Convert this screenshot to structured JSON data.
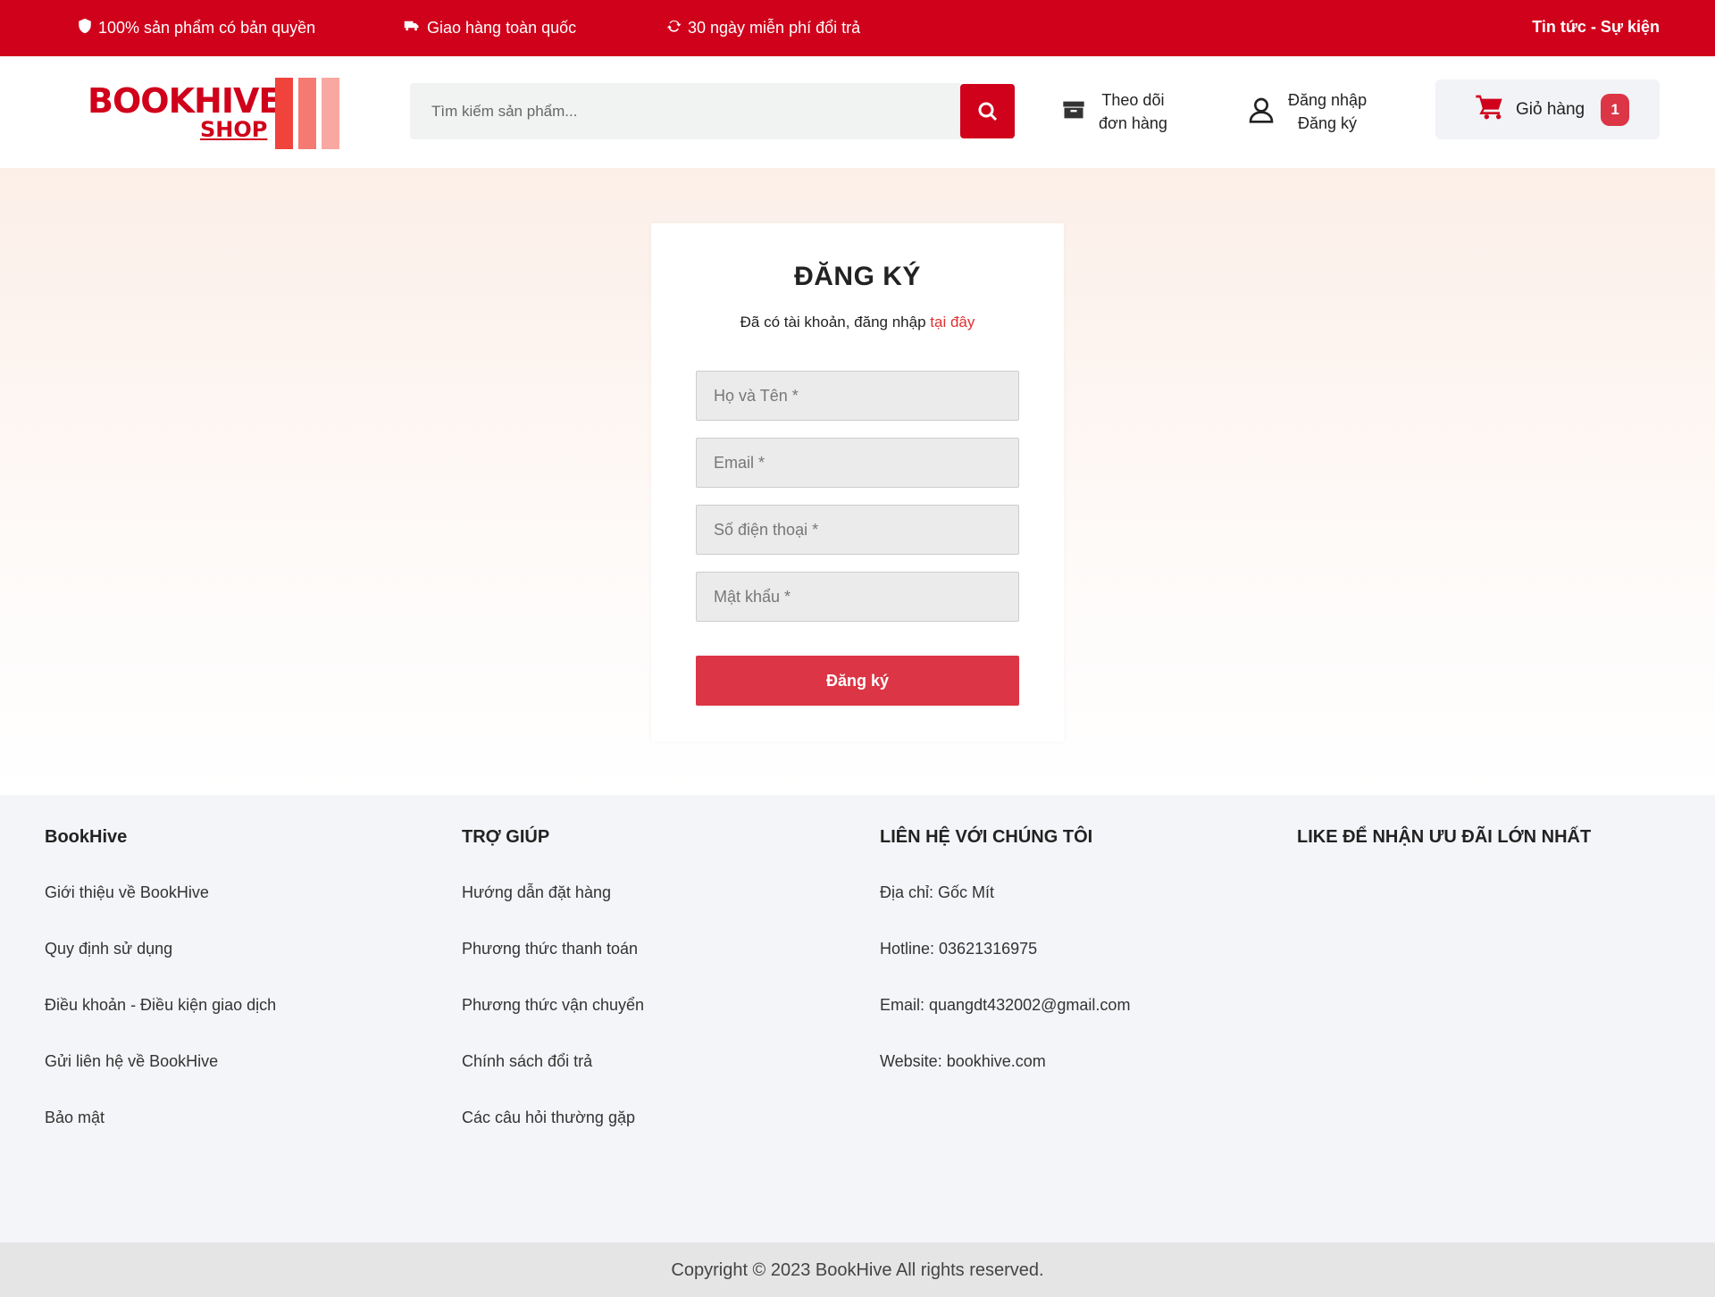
{
  "topbar": {
    "perks": [
      {
        "icon": "shield-icon",
        "label": "100% sản phẩm có bản quyền"
      },
      {
        "icon": "truck-icon",
        "label": "Giao hàng toàn quốc"
      },
      {
        "icon": "refresh-icon",
        "label": "30 ngày miễn phí đổi trả"
      }
    ],
    "news_link": "Tin tức - Sự kiện",
    "background_color": "#d0011b"
  },
  "header": {
    "logo": {
      "word1": "BOOKHIVE",
      "word2": "SHOP",
      "colors": [
        "#f0433c",
        "#f47a72",
        "#f8a8a0"
      ]
    },
    "search": {
      "placeholder": "Tìm kiếm sản phẩm..."
    },
    "track_order": {
      "line1": "Theo dõi",
      "line2": "đơn hàng"
    },
    "account": {
      "login": "Đăng nhập",
      "register": "Đăng ký"
    },
    "cart": {
      "label": "Giỏ hàng",
      "count": "1"
    }
  },
  "register_form": {
    "title": "ĐĂNG KÝ",
    "have_account_text": "Đã có tài khoản, đăng nhập ",
    "login_link": "tại đây",
    "fields": [
      {
        "placeholder": "Họ và Tên *"
      },
      {
        "placeholder": "Email *"
      },
      {
        "placeholder": "Số điện thoại *"
      },
      {
        "placeholder": "Mật khẩu *"
      }
    ],
    "submit_label": "Đăng ký",
    "accent_color": "#dc3545"
  },
  "footer": {
    "columns": [
      {
        "title": "BookHive",
        "items": [
          "Giới thiệu về BookHive",
          "Quy định sử dụng",
          "Điều khoản - Điều kiện giao dịch",
          "Gửi liên hệ về BookHive",
          "Bảo mật"
        ]
      },
      {
        "title": "TRỢ GIÚP",
        "items": [
          "Hướng dẫn đặt hàng",
          "Phương thức thanh toán",
          "Phương thức vận chuyển",
          "Chính sách đổi trả",
          "Các câu hỏi thường gặp"
        ]
      },
      {
        "title": "LIÊN HỆ VỚI CHÚNG TÔI",
        "items": [
          "Địa chỉ: Gốc Mít",
          "Hotline: 03621316975",
          "Email: quangdt432002@gmail.com",
          "Website: bookhive.com"
        ]
      },
      {
        "title": "LIKE ĐỂ NHẬN ƯU ĐÃI LỚN NHẤT",
        "items": []
      }
    ],
    "copyright": "Copyright © 2023 BookHive All rights reserved."
  }
}
